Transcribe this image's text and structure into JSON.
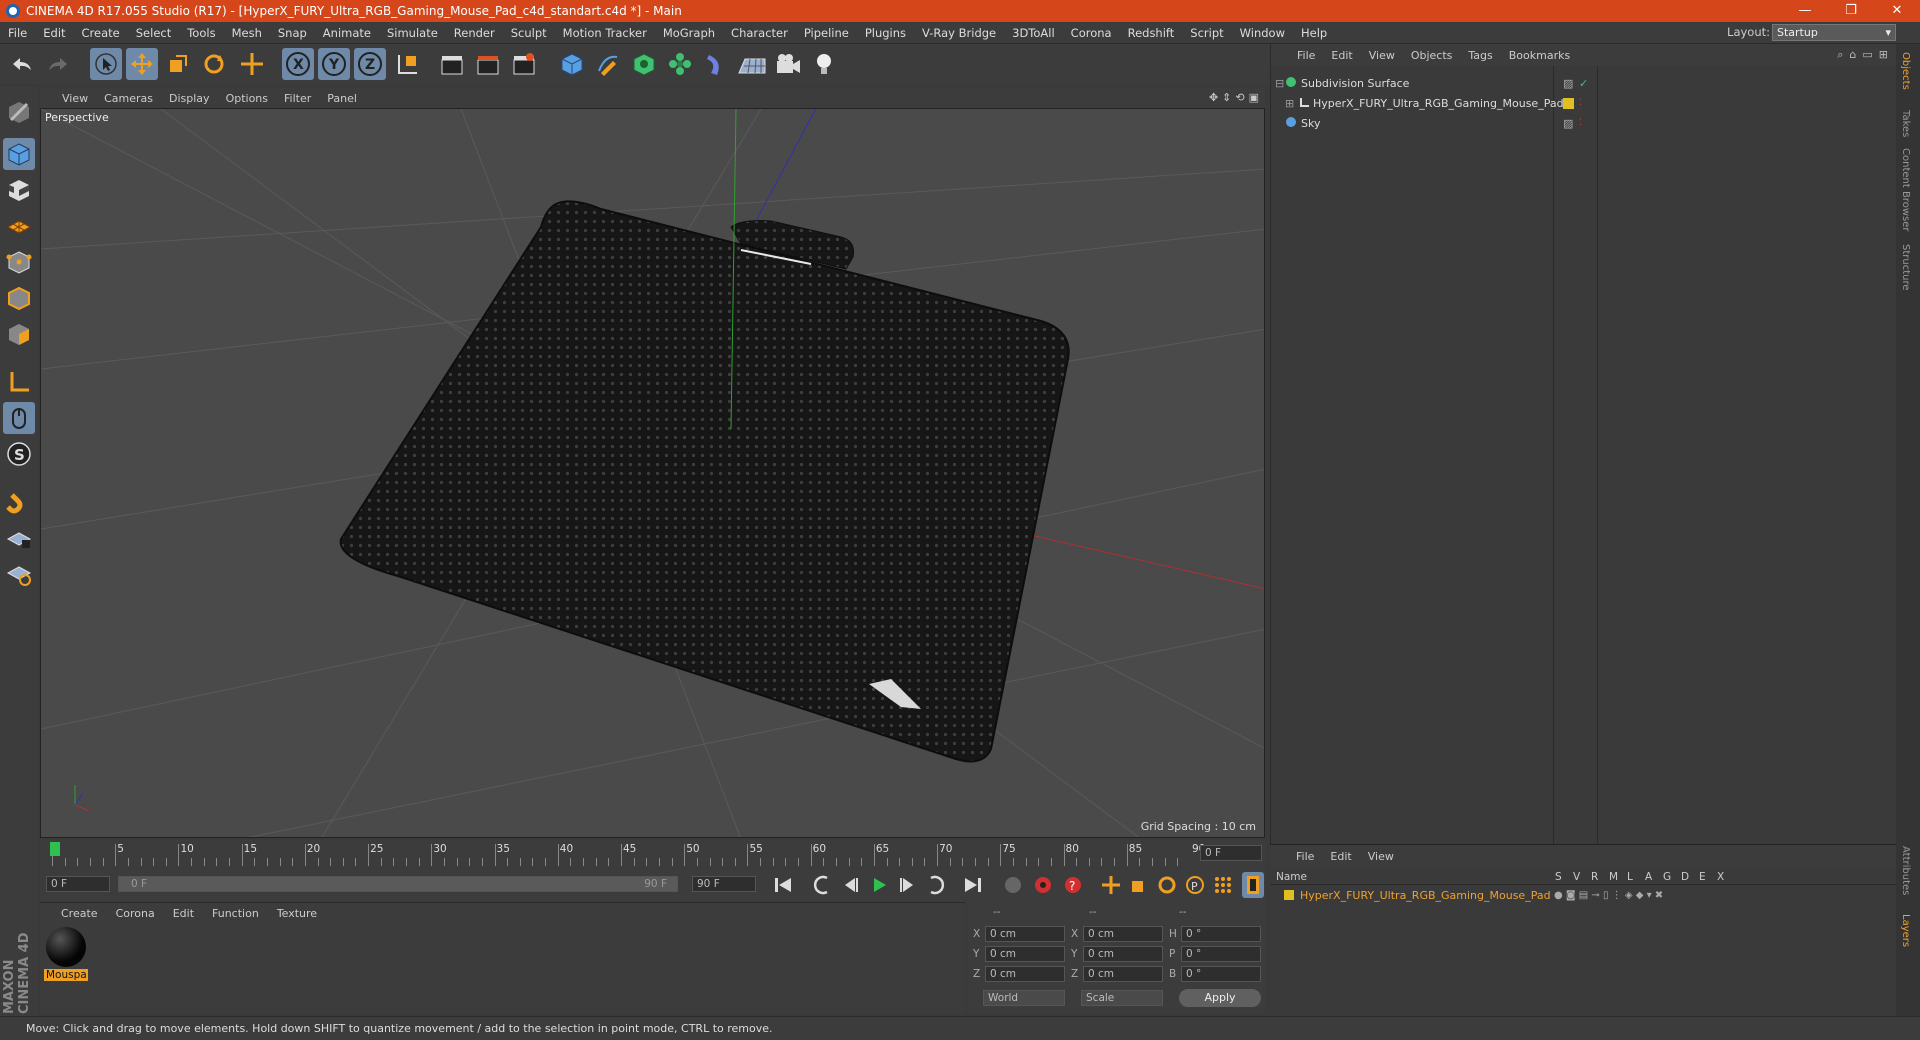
{
  "window": {
    "title": "CINEMA 4D R17.055 Studio (R17) - [HyperX_FURY_Ultra_RGB_Gaming_Mouse_Pad_c4d_standart.c4d *] - Main",
    "minimize": "—",
    "restore": "❐",
    "close": "✕"
  },
  "menubar": {
    "items": [
      "File",
      "Edit",
      "Create",
      "Select",
      "Tools",
      "Mesh",
      "Snap",
      "Animate",
      "Simulate",
      "Render",
      "Sculpt",
      "Motion Tracker",
      "MoGraph",
      "Character",
      "Pipeline",
      "Plugins",
      "V-Ray Bridge",
      "3DToAll",
      "Corona",
      "Redshift",
      "Script",
      "Window",
      "Help"
    ],
    "layout_label": "Layout:",
    "layout_value": "Startup"
  },
  "viewport": {
    "menu": [
      "View",
      "Cameras",
      "Display",
      "Options",
      "Filter",
      "Panel"
    ],
    "label": "Perspective",
    "grid_spacing": "Grid Spacing : 10 cm"
  },
  "timeline": {
    "ticks": [
      "0",
      "5",
      "10",
      "15",
      "20",
      "25",
      "30",
      "35",
      "40",
      "45",
      "50",
      "55",
      "60",
      "65",
      "70",
      "75",
      "80",
      "85",
      "90"
    ],
    "end_frame_field": "0 F",
    "start_field": "0 F",
    "range_start": "0 F",
    "range_end": "90 F",
    "max_field": "90 F",
    "current_frame": 0
  },
  "materials": {
    "menu": [
      "Create",
      "Corona",
      "Edit",
      "Function",
      "Texture"
    ],
    "items": [
      {
        "name": "Mouspa"
      }
    ]
  },
  "coords": {
    "header": [
      "--",
      "--",
      "--"
    ],
    "rows": [
      {
        "l1": "X",
        "v1": "0 cm",
        "l2": "X",
        "v2": "0 cm",
        "l3": "H",
        "v3": "0 °"
      },
      {
        "l1": "Y",
        "v1": "0 cm",
        "l2": "Y",
        "v2": "0 cm",
        "l3": "P",
        "v3": "0 °"
      },
      {
        "l1": "Z",
        "v1": "0 cm",
        "l2": "Z",
        "v2": "0 cm",
        "l3": "B",
        "v3": "0 °"
      }
    ],
    "world": "World",
    "scale": "Scale",
    "apply": "Apply"
  },
  "objects": {
    "menu": [
      "File",
      "Edit",
      "View",
      "Objects",
      "Tags",
      "Bookmarks"
    ],
    "rows": [
      {
        "name": "Subdivision Surface"
      },
      {
        "name": "HyperX_FURY_Ultra_RGB_Gaming_Mouse_Pad"
      },
      {
        "name": "Sky"
      }
    ]
  },
  "layers": {
    "menu": [
      "File",
      "Edit",
      "View"
    ],
    "columns": [
      "Name",
      "S",
      "V",
      "R",
      "M",
      "L",
      "A",
      "G",
      "D",
      "E",
      "X"
    ],
    "rows": [
      {
        "name": "HyperX_FURY_Ultra_RGB_Gaming_Mouse_Pad"
      }
    ]
  },
  "right_tabs": [
    "Objects",
    "Takes",
    "Content Browser",
    "Structure",
    "Attributes",
    "Layers"
  ],
  "status": "Move: Click and drag to move elements. Hold down SHIFT to quantize movement / add to the selection in point mode, CTRL to remove.",
  "branding": "MAXON CINEMA 4D",
  "colors": {
    "titlebar": "#d5461a",
    "selected_tool": "#6e8aa8",
    "layer_yellow": "#e0c020",
    "layer_text": "#f0a030"
  }
}
